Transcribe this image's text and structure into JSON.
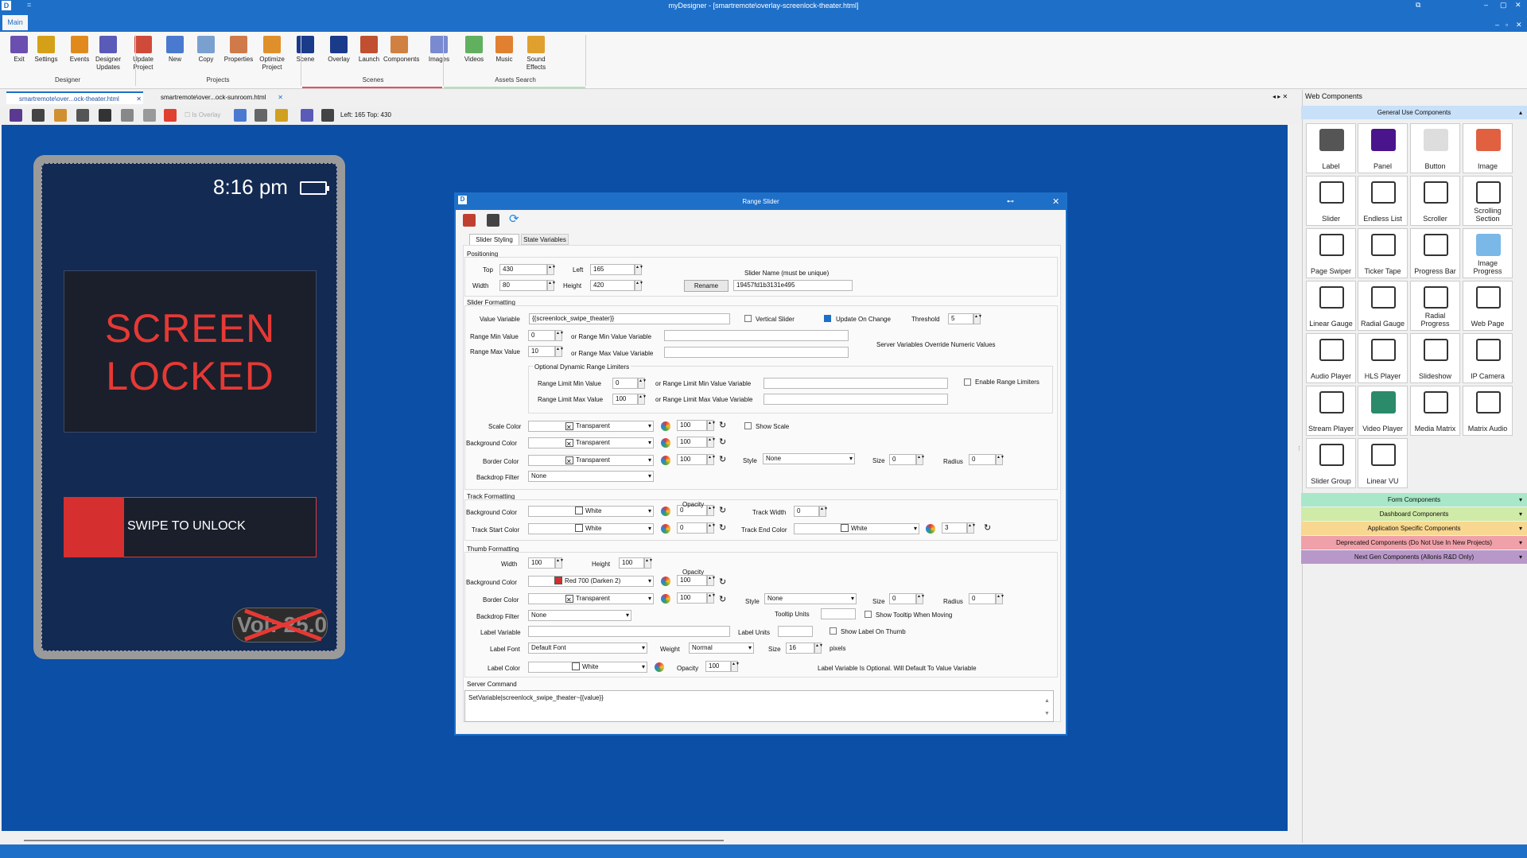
{
  "app": {
    "title": "myDesigner - [smartremote\\overlay-screenlock-theater.html]",
    "ribbon_tab": "Main",
    "quick_access": "="
  },
  "ribbon": {
    "buttons": [
      {
        "label": "Exit",
        "color": "#6a4fb0"
      },
      {
        "label": "Settings",
        "color": "#d4a017"
      },
      {
        "label": "Events",
        "color": "#e08a1e"
      },
      {
        "label": "Designer Updates",
        "color": "#5a5ab8"
      },
      {
        "label": "Update Project",
        "color": "#d04a3a"
      },
      {
        "label": "New",
        "color": "#4a7ad0"
      },
      {
        "label": "Copy",
        "color": "#7aa0d0"
      },
      {
        "label": "Properties",
        "color": "#d07a4a"
      },
      {
        "label": "Optimize Project",
        "color": "#e0902a"
      },
      {
        "label": "Scene",
        "color": "#1a3a8a"
      },
      {
        "label": "Overlay",
        "color": "#1a3a8a"
      },
      {
        "label": "Launch",
        "color": "#c05030"
      },
      {
        "label": "Components",
        "color": "#d08040"
      },
      {
        "label": "Images",
        "color": "#7a8ad0"
      },
      {
        "label": "Videos",
        "color": "#60b060"
      },
      {
        "label": "Music",
        "color": "#e08030"
      },
      {
        "label": "Sound Effects",
        "color": "#e0a030"
      }
    ],
    "groups": [
      "Designer",
      "Projects",
      "Scenes",
      "Assets Search"
    ]
  },
  "doc_tabs": [
    "smartremote\\over...ock-theater.html",
    "smartremote\\over...ock-sunroom.html"
  ],
  "toolbar": {
    "overlay_label": "Is Overlay",
    "position_readout": "Left: 165  Top: 430"
  },
  "phone": {
    "time": "8:16 pm",
    "lock_line1": "SCREEN",
    "lock_line2": "LOCKED",
    "swipe_text": "SWIPE TO UNLOCK",
    "vol_text": "Vol: 25.0"
  },
  "dialog": {
    "title": "Range Slider",
    "tabs": [
      "Slider Styling",
      "State Variables"
    ],
    "positioning": {
      "section": "Positioning",
      "top_label": "Top",
      "top": "430",
      "left_label": "Left",
      "left": "165",
      "width_label": "Width",
      "width": "80",
      "height_label": "Height",
      "height": "420",
      "rename": "Rename",
      "name_label": "Slider Name (must be unique)",
      "name": "19457fd1b3131e495"
    },
    "formatting": {
      "section": "Slider Formatting",
      "value_var_label": "Value Variable",
      "value_var": "{{screenlock_swipe_theater}}",
      "vertical_label": "Vertical Slider",
      "update_label": "Update On Change",
      "threshold_label": "Threshold",
      "threshold": "5",
      "min_label": "Range Min Value",
      "min": "0",
      "min_var_label": "or Range Min Value Variable",
      "max_label": "Range Max Value",
      "max": "10",
      "max_var_label": "or Range Max Value Variable",
      "override_note": "Server Variables Override Numeric Values",
      "limiters_title": "Optional Dynamic Range Limiters",
      "limit_min_label": "Range Limit Min Value",
      "limit_min": "0",
      "limit_min_var_label": "or Range Limit Min Value Variable",
      "limit_max_label": "Range Limit Max Value",
      "limit_max": "100",
      "limit_max_var_label": "or Range Limit Max Value Variable",
      "enable_limiters_label": "Enable Range Limiters",
      "scale_color_label": "Scale Color",
      "scale_color": "Transparent",
      "scale_opacity": "100",
      "show_scale_label": "Show Scale",
      "bg_color_label": "Background Color",
      "bg_color": "Transparent",
      "bg_opacity": "100",
      "border_color_label": "Border Color",
      "border_color": "Transparent",
      "border_opacity": "100",
      "style_label": "Style",
      "style": "None",
      "size_label": "Size",
      "size": "0",
      "radius_label": "Radius",
      "radius": "0",
      "backdrop_label": "Backdrop Filter",
      "backdrop": "None"
    },
    "track": {
      "section": "Track Formatting",
      "opacity_label": "Opacity",
      "bg_color_label": "Background Color",
      "bg_color": "White",
      "bg_opacity": "0",
      "track_width_label": "Track Width",
      "track_width": "0",
      "start_color_label": "Track Start Color",
      "start_color": "White",
      "start_opacity": "0",
      "end_color_label": "Track End Color",
      "end_color": "White",
      "end_opacity": "3"
    },
    "thumb": {
      "section": "Thumb Formatting",
      "width_label": "Width",
      "width": "100",
      "height_label": "Height",
      "height": "100",
      "opacity_label": "Opacity",
      "bg_color_label": "Background Color",
      "bg_color": "Red 700 (Darken 2)",
      "bg_swatch": "#d32f2f",
      "bg_opacity": "100",
      "border_color_label": "Border Color",
      "border_color": "Transparent",
      "border_opacity": "100",
      "style_label": "Style",
      "style": "None",
      "size_label": "Size",
      "size": "0",
      "radius_label": "Radius",
      "radius": "0",
      "backdrop_label": "Backdrop Filter",
      "backdrop": "None",
      "tooltip_units_label": "Tooltip Units",
      "show_tooltip_label": "Show Tooltip When Moving",
      "label_var_label": "Label Variable",
      "label_units_label": "Label Units",
      "show_label_label": "Show Label On Thumb",
      "label_font_label": "Label Font",
      "label_font": "Default Font",
      "weight_label": "Weight",
      "weight": "Normal",
      "font_size_label": "Size",
      "font_size": "16",
      "pixels_label": "pixels",
      "label_color_label": "Label Color",
      "label_color": "White",
      "label_opacity_label": "Opacity",
      "label_opacity": "100",
      "label_note": "Label Variable Is Optional. Will Default To Value Variable"
    },
    "server": {
      "section": "Server Command",
      "command": "SetVariable|screenlock_swipe_theater~{{value}}"
    }
  },
  "right_panel": {
    "title": "Web Components",
    "categories": [
      {
        "label": "General Use Components",
        "color": "#c8e0f8"
      },
      {
        "label": "Form Components",
        "color": "#a8e8c8"
      },
      {
        "label": "Dashboard Components",
        "color": "#d0eaa8"
      },
      {
        "label": "Application Specific Components",
        "color": "#f8d890"
      },
      {
        "label": "Deprecated Components (Do Not Use In New Projects)",
        "color": "#f0a0a8"
      },
      {
        "label": "Next Gen Components (Allonis R&D Only)",
        "color": "#b898c8"
      }
    ],
    "components": [
      {
        "label": "Label",
        "color": "#555"
      },
      {
        "label": "Panel",
        "color": "#4a148c"
      },
      {
        "label": "Button",
        "color": "#ddd"
      },
      {
        "label": "Image",
        "color": "#e06040"
      },
      {
        "label": "Slider",
        "color": "#fff"
      },
      {
        "label": "Endless List",
        "color": "#fff"
      },
      {
        "label": "Scroller",
        "color": "#fff"
      },
      {
        "label": "Scrolling Section",
        "color": "#fff"
      },
      {
        "label": "Page Swiper",
        "color": "#fff"
      },
      {
        "label": "Ticker Tape",
        "color": "#fff"
      },
      {
        "label": "Progress Bar",
        "color": "#fff"
      },
      {
        "label": "Image Progress",
        "color": "#7ab8e8"
      },
      {
        "label": "Linear Gauge",
        "color": "#fff"
      },
      {
        "label": "Radial Gauge",
        "color": "#fff"
      },
      {
        "label": "Radial Progress",
        "color": "#fff"
      },
      {
        "label": "Web Page",
        "color": "#fff"
      },
      {
        "label": "Audio Player",
        "color": "#fff"
      },
      {
        "label": "HLS Player",
        "color": "#fff"
      },
      {
        "label": "Slideshow",
        "color": "#fff"
      },
      {
        "label": "IP Camera",
        "color": "#fff"
      },
      {
        "label": "Stream Player",
        "color": "#fff"
      },
      {
        "label": "Video Player",
        "color": "#2a8a6a"
      },
      {
        "label": "Media Matrix",
        "color": "#fff"
      },
      {
        "label": "Matrix Audio",
        "color": "#fff"
      },
      {
        "label": "Slider Group",
        "color": "#fff"
      },
      {
        "label": "Linear VU",
        "color": "#fff"
      }
    ]
  }
}
